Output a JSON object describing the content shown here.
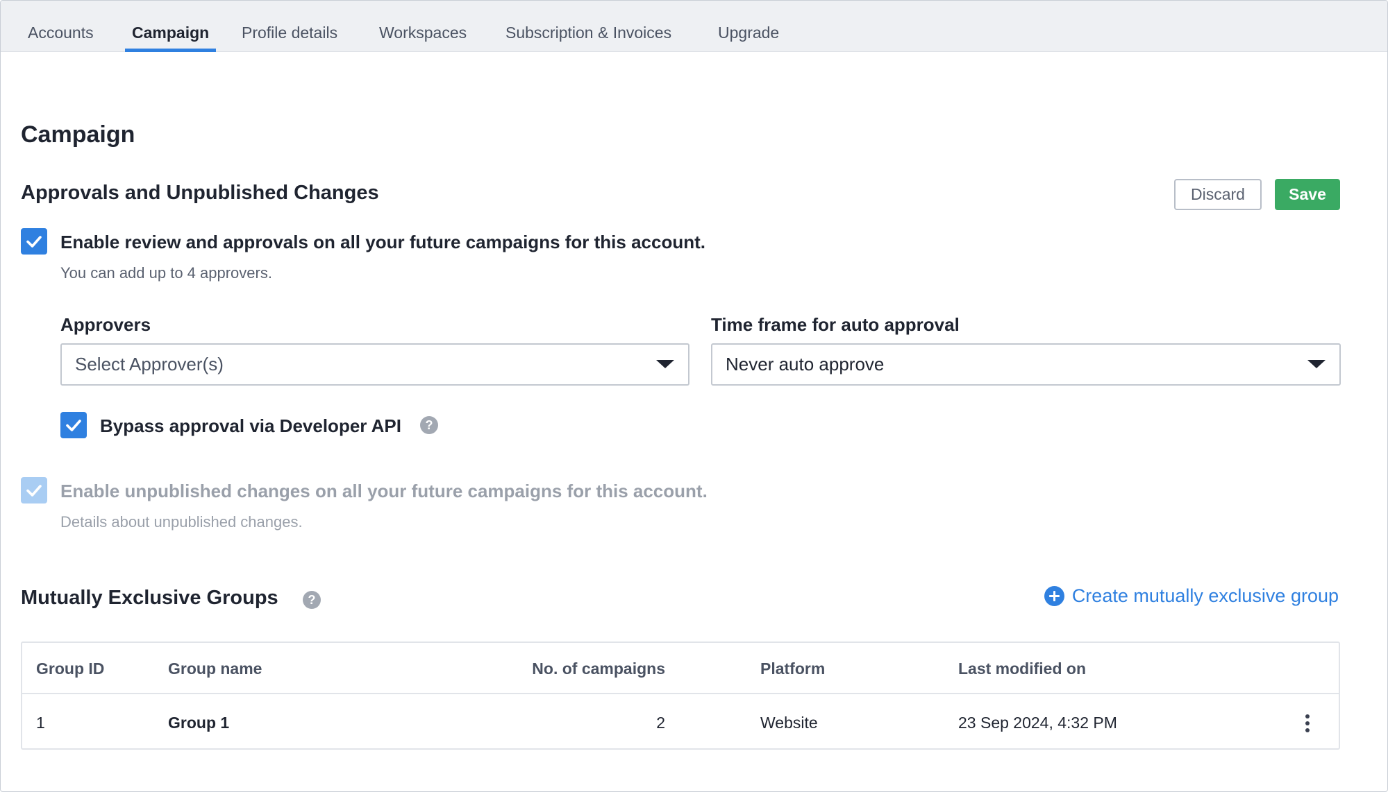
{
  "tabs": [
    {
      "label": "Accounts",
      "active": false
    },
    {
      "label": "Campaign",
      "active": true
    },
    {
      "label": "Profile details",
      "active": false
    },
    {
      "label": "Workspaces",
      "active": false
    },
    {
      "label": "Subscription & Invoices",
      "active": false
    },
    {
      "label": "Upgrade",
      "active": false
    }
  ],
  "page_title": "Campaign",
  "approvals": {
    "title": "Approvals and Unpublished Changes",
    "discard_label": "Discard",
    "save_label": "Save",
    "enable_review": {
      "checked": true,
      "label": "Enable review and approvals on all your future campaigns for this account.",
      "hint": "You can add up to 4 approvers."
    },
    "approvers": {
      "label": "Approvers",
      "placeholder": "Select Approver(s)"
    },
    "time_frame": {
      "label": "Time frame for auto approval",
      "value": "Never auto approve"
    },
    "bypass": {
      "checked": true,
      "label": "Bypass approval via Developer API",
      "help_icon": "question-circle-icon"
    },
    "unpublished": {
      "checked": true,
      "disabled": true,
      "label": "Enable unpublished changes on all your future campaigns for this account.",
      "hint": "Details about unpublished changes."
    }
  },
  "groups": {
    "title": "Mutually Exclusive Groups",
    "help_icon": "question-circle-icon",
    "create_label": "Create mutually exclusive group",
    "columns": [
      "Group ID",
      "Group name",
      "No. of campaigns",
      "Platform",
      "Last modified on"
    ],
    "rows": [
      {
        "id": "1",
        "name": "Group 1",
        "campaigns": "2",
        "platform": "Website",
        "modified": "23 Sep 2024, 4:32 PM"
      }
    ]
  },
  "colors": {
    "accent": "#2f80e0",
    "save": "#3aaa63",
    "checkbox_disabled": "#a9cdf3"
  }
}
